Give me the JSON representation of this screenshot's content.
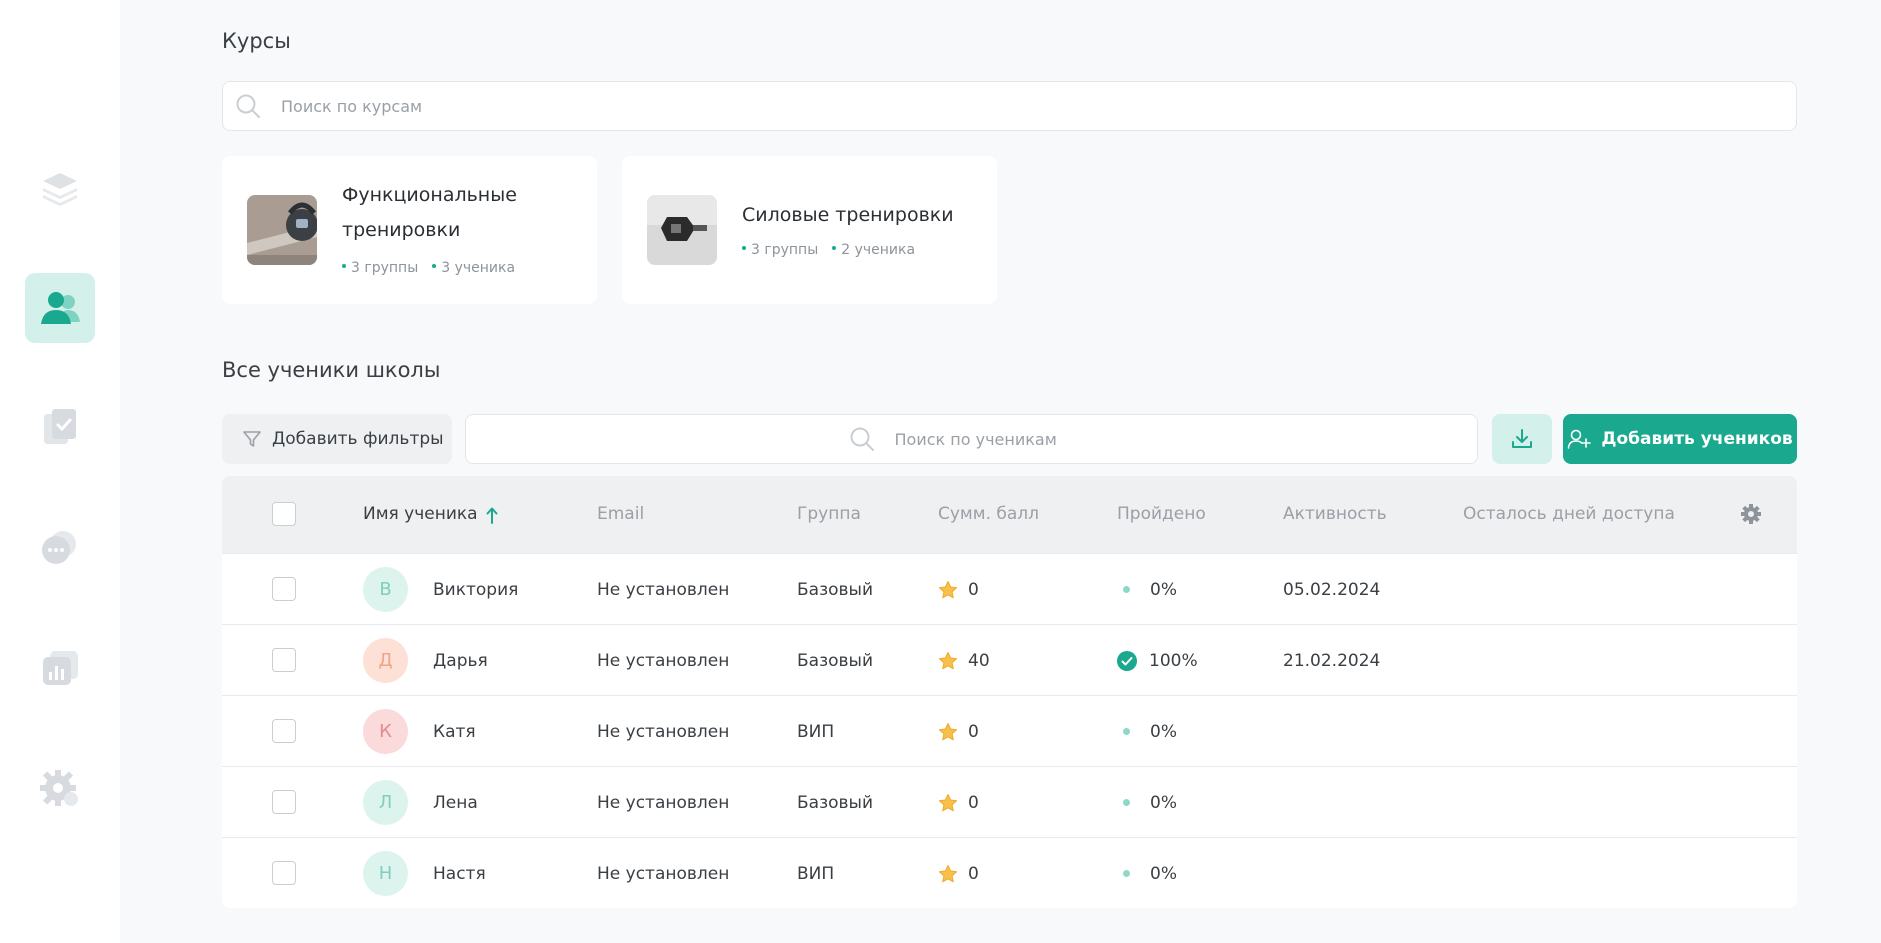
{
  "sidebar": {
    "items": [
      {
        "icon": "layers-icon",
        "active": false
      },
      {
        "icon": "users-icon",
        "active": true
      },
      {
        "icon": "document-check-icon",
        "active": false
      },
      {
        "icon": "chat-icon",
        "active": false
      },
      {
        "icon": "analytics-icon",
        "active": false
      },
      {
        "icon": "settings-gear-icon",
        "active": false
      }
    ]
  },
  "courses": {
    "title": "Курсы",
    "search_placeholder": "Поиск по курсам",
    "cards": [
      {
        "name_line1": "Функциональные",
        "name_line2": "тренировки",
        "groups": "3 группы",
        "students": "3 ученика"
      },
      {
        "name_line1": "Силовые тренировки",
        "name_line2": "",
        "groups": "3 группы",
        "students": "2 ученика"
      }
    ]
  },
  "students": {
    "title": "Все ученики школы",
    "filter_label": "Добавить фильтры",
    "search_placeholder": "Поиск по ученикам",
    "add_label": "Добавить учеников",
    "columns": {
      "name": "Имя ученика",
      "email": "Email",
      "group": "Группа",
      "score": "Сумм. балл",
      "progress": "Пройдено",
      "activity": "Активность",
      "days_left": "Осталось дней доступа"
    },
    "rows": [
      {
        "initial": "В",
        "name": "Виктория",
        "email": "Не установлен",
        "group": "Базовый",
        "score": "0",
        "progress": "0%",
        "completed": false,
        "activity": "05.02.2024"
      },
      {
        "initial": "Д",
        "name": "Дарья",
        "email": "Не установлен",
        "group": "Базовый",
        "score": "40",
        "progress": "100%",
        "completed": true,
        "activity": "21.02.2024"
      },
      {
        "initial": "К",
        "name": "Катя",
        "email": "Не установлен",
        "group": "ВИП",
        "score": "0",
        "progress": "0%",
        "completed": false,
        "activity": ""
      },
      {
        "initial": "Л",
        "name": "Лена",
        "email": "Не установлен",
        "group": "Базовый",
        "score": "0",
        "progress": "0%",
        "completed": false,
        "activity": ""
      },
      {
        "initial": "Н",
        "name": "Настя",
        "email": "Не установлен",
        "group": "ВИП",
        "score": "0",
        "progress": "0%",
        "completed": false,
        "activity": ""
      }
    ]
  },
  "colors": {
    "accent": "#1aa88f",
    "accent_light": "#d4f0eb",
    "star": "#f7c04a"
  }
}
